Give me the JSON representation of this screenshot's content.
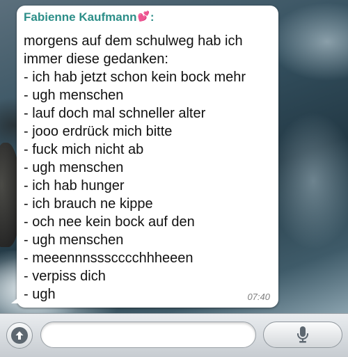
{
  "chat": {
    "message": {
      "sender": "Fabienne Kaufmann",
      "sender_suffix": ":",
      "sender_emoji": "💕",
      "lines": [
        "morgens auf dem schulweg hab ich",
        "immer diese gedanken:",
        "- ich hab jetzt schon kein bock mehr",
        "- ugh menschen",
        "- lauf doch mal schneller alter",
        "- jooo erdrück mich bitte",
        "- fuck mich nicht ab",
        "- ugh menschen",
        "- ich hab hunger",
        "- ich brauch ne kippe",
        "- och nee kein bock auf den",
        "- ugh menschen",
        "- meeennnssscccchhheeen",
        "- verpiss dich",
        "- ugh"
      ],
      "time": "07:40"
    }
  },
  "composer": {
    "input_value": "",
    "attach_icon": "arrow-up-circle-icon",
    "mic_icon": "microphone-icon"
  },
  "colors": {
    "sender_name": "#2c8e88",
    "heart": "#ff5fa2",
    "bubble": "#ffffff"
  }
}
